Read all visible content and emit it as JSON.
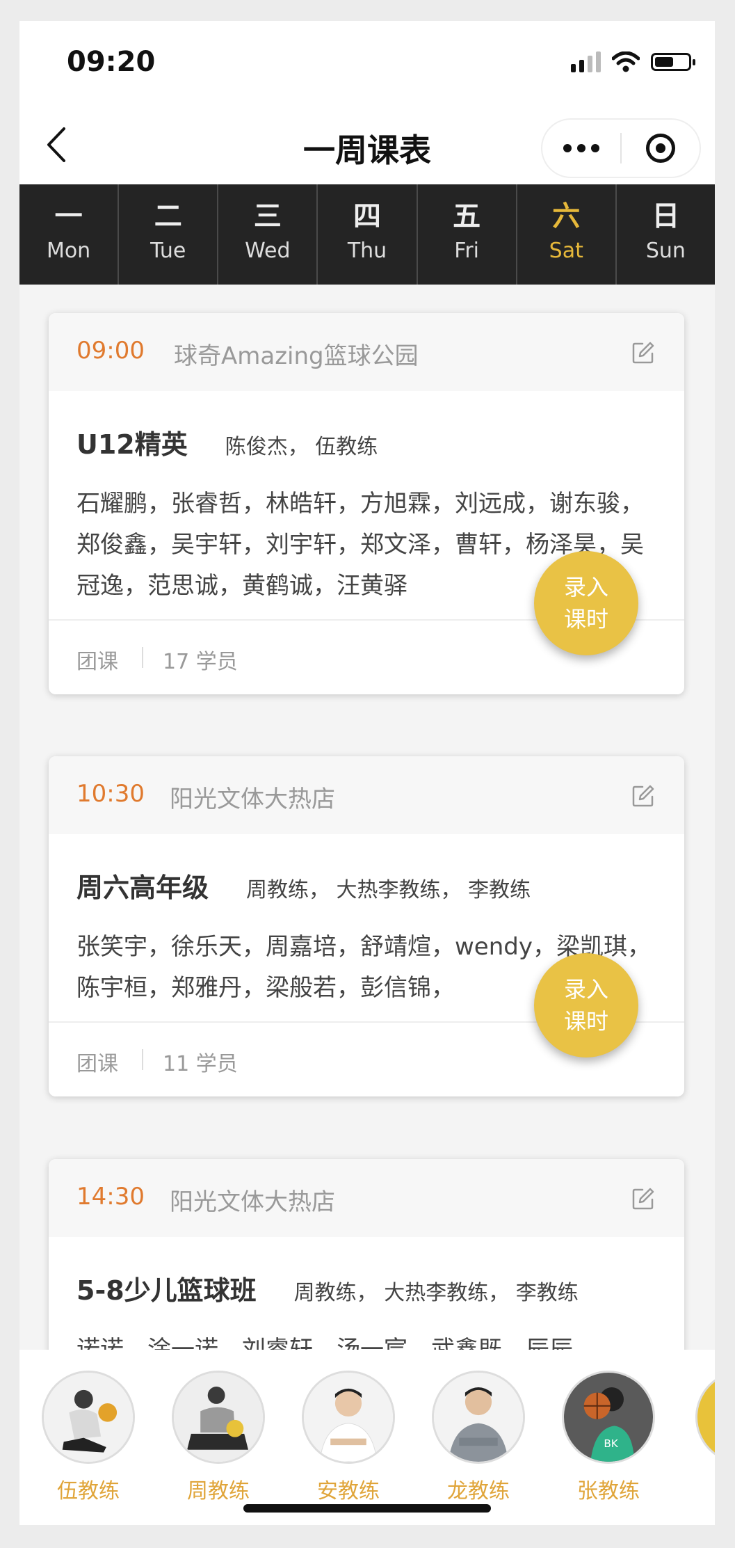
{
  "status_bar": {
    "time": "09:20"
  },
  "nav": {
    "title": "一周课表"
  },
  "week": [
    {
      "cn": "一",
      "en": "Mon",
      "active": false
    },
    {
      "cn": "二",
      "en": "Tue",
      "active": false
    },
    {
      "cn": "三",
      "en": "Wed",
      "active": false
    },
    {
      "cn": "四",
      "en": "Thu",
      "active": false
    },
    {
      "cn": "五",
      "en": "Fri",
      "active": false
    },
    {
      "cn": "六",
      "en": "Sat",
      "active": true
    },
    {
      "cn": "日",
      "en": "Sun",
      "active": false
    }
  ],
  "classes": [
    {
      "time": "09:00",
      "location": "球奇Amazing篮球公园",
      "name": "U12精英",
      "coaches": "陈俊杰， 伍教练",
      "students": "石耀鹏，张睿哲，林皓轩，方旭霖，刘远成，谢东骏，郑俊鑫，吴宇轩，刘宇轩，郑文泽，曹轩，杨泽昊，吴冠逸，范思诚，黄鹤诚，汪黄驿",
      "type": "团课",
      "count": "17 学员",
      "record_label": [
        "录入",
        "课时"
      ]
    },
    {
      "time": "10:30",
      "location": "阳光文体大热店",
      "name": "周六高年级",
      "coaches": "周教练， 大热李教练， 李教练",
      "students": "张笑宇，徐乐天，周嘉培，舒靖煊，wendy，梁凯琪，陈宇桓，郑雅丹，梁般若，彭信锦，",
      "type": "团课",
      "count": "11 学员",
      "record_label": [
        "录入",
        "课时"
      ]
    },
    {
      "time": "14:30",
      "location": "阳光文体大热店",
      "name": "5-8少儿篮球班",
      "coaches": "周教练， 大热李教练， 李教练",
      "students": "诺诺，涂一诺，刘睿轩，汤一宸，武鑫既，辰辰"
    }
  ],
  "coach_tabs": [
    {
      "name": "伍教练"
    },
    {
      "name": "周教练"
    },
    {
      "name": "安教练"
    },
    {
      "name": "龙教练"
    },
    {
      "name": "张教练"
    }
  ],
  "colors": {
    "accent_orange": "#e07a2e",
    "active_gold": "#e6b83a",
    "fab_yellow": "#e9c245",
    "week_bg": "#242424"
  }
}
